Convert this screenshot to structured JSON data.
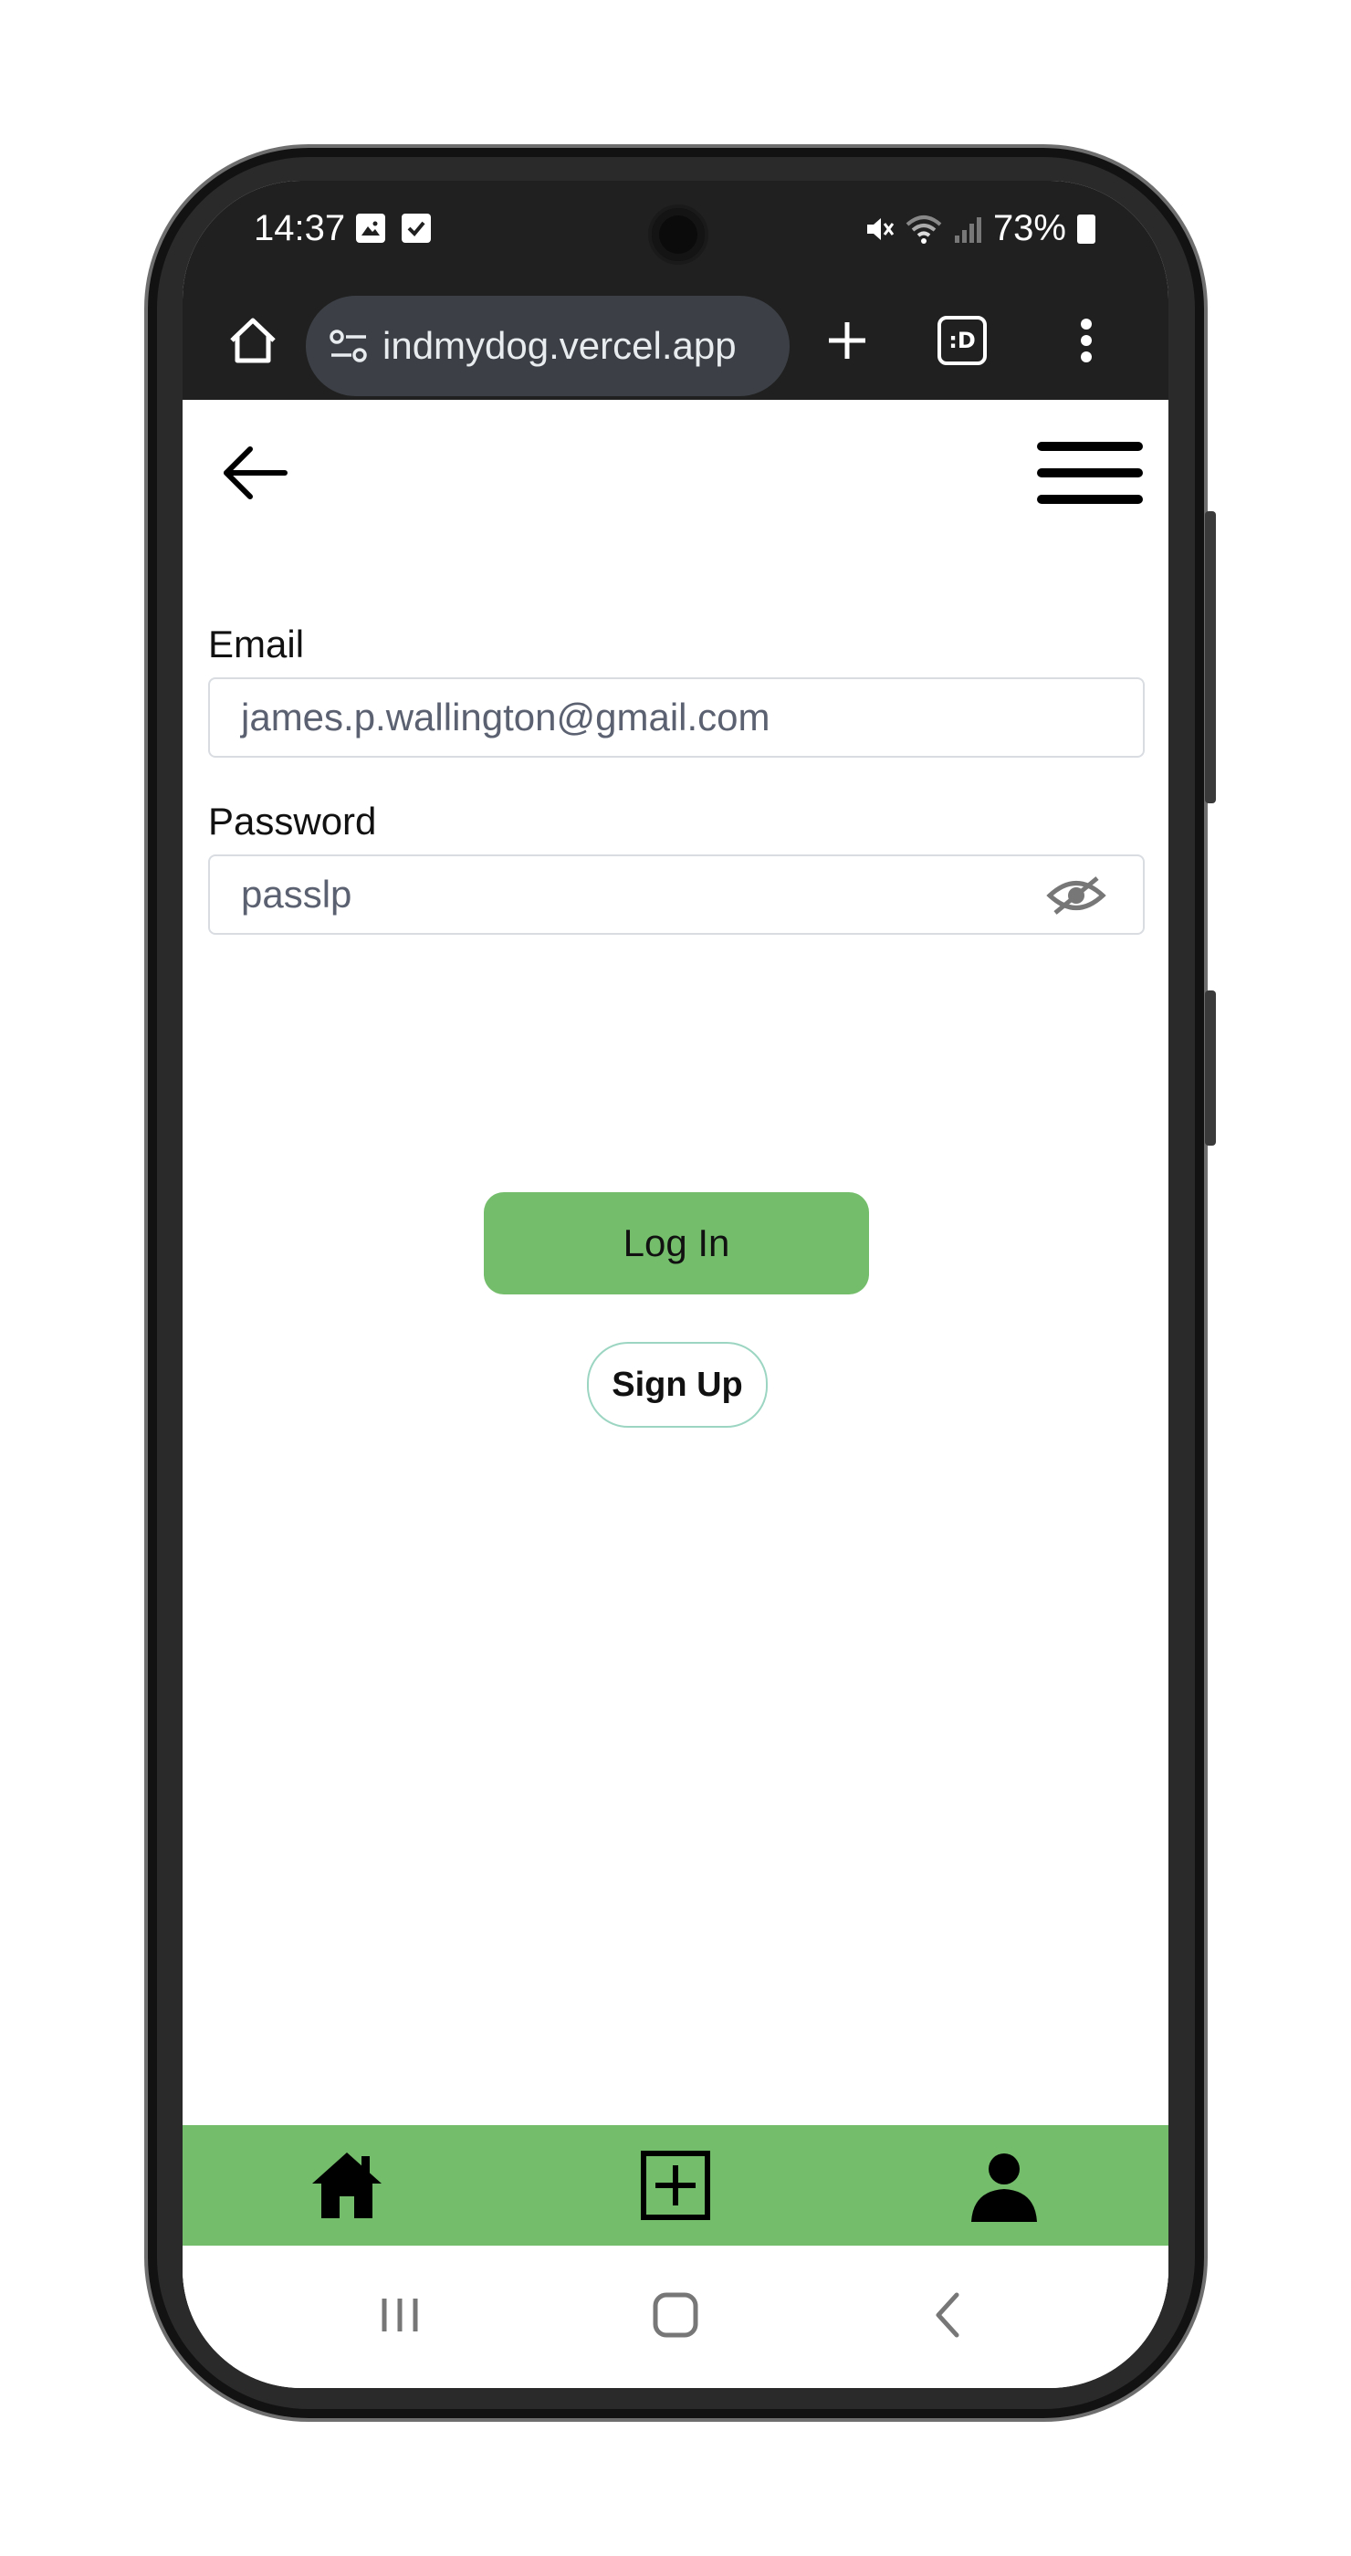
{
  "status": {
    "time": "14:37",
    "battery": "73%"
  },
  "browser": {
    "url": "indmydog.vercel.app",
    "tab_count": ":D"
  },
  "form": {
    "email_label": "Email",
    "email_value": "james.p.wallington@gmail.com",
    "password_label": "Password",
    "password_value": "passlp",
    "login_label": "Log In",
    "signup_label": "Sign Up"
  },
  "colors": {
    "accent": "#74be6b",
    "chrome": "#202020"
  },
  "icons": {
    "back": "arrow-left-icon",
    "menu": "hamburger-icon",
    "toggle_password": "eye-off-icon",
    "bottom_nav": [
      "home-icon",
      "add-square-icon",
      "user-icon"
    ]
  }
}
